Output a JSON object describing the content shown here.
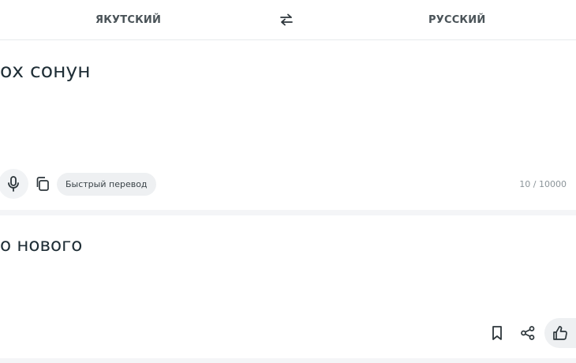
{
  "languages": {
    "source": "ЯКУТСКИЙ",
    "target": "РУССКИЙ"
  },
  "input": {
    "text": "ох сонун",
    "mode_label": "Быстрый перевод",
    "counter": "10 / 10000"
  },
  "output": {
    "text": "о нового"
  },
  "icons": {
    "swap": "swap-arrows-icon",
    "mic": "microphone-icon",
    "copy": "copy-icon",
    "mode_chevron": "chevron-down-icon",
    "bookmark": "bookmark-icon",
    "share": "share-icon",
    "like": "thumbs-up-icon"
  },
  "colors": {
    "text": "#1f2e36",
    "muted": "#8b9499",
    "pill_bg": "#eef0f2"
  }
}
